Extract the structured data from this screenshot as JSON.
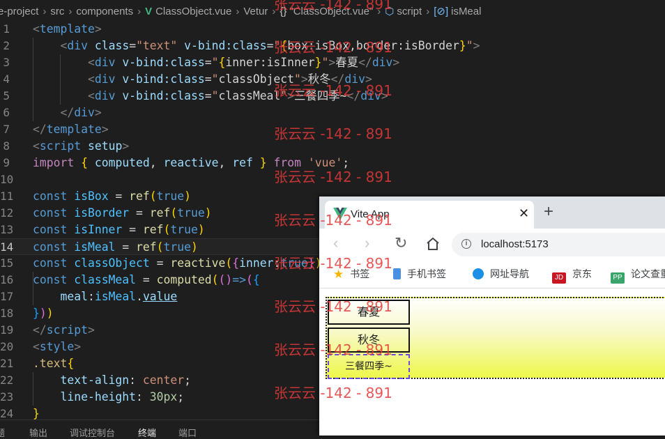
{
  "breadcrumb": {
    "project": "e-project",
    "folder1": "src",
    "folder2": "components",
    "file": "ClassObject.vue",
    "vetur": "Vetur",
    "braces_icon": "{}",
    "component": "\"ClassObject.vue\"",
    "script": "script",
    "symbol": "isMeal"
  },
  "editor": {
    "current_line": 14,
    "line_numbers": [
      "1",
      "2",
      "3",
      "4",
      "5",
      "6",
      "7",
      "8",
      "9",
      "10",
      "11",
      "12",
      "13",
      "14",
      "15",
      "16",
      "17",
      "18",
      "19",
      "20",
      "21",
      "22",
      "23",
      "24"
    ]
  },
  "panel_tabs": [
    "题",
    "输出",
    "调试控制台",
    "终端",
    "端口"
  ],
  "watermark": "张云云 -142 - 891",
  "browser": {
    "tab_title": "Vite App",
    "url": "localhost:5173",
    "bookmarks": [
      "书签",
      "手机书签",
      "网址导航",
      "京东",
      "论文查重"
    ],
    "demo": [
      "春夏",
      "秋冬",
      "三餐四季~"
    ]
  },
  "colors": {
    "editor_bg": "#1e1e1e",
    "vue_green": "#41b883",
    "watermark_red": "#e23a3a",
    "demo_yellow": "#eef84a"
  }
}
